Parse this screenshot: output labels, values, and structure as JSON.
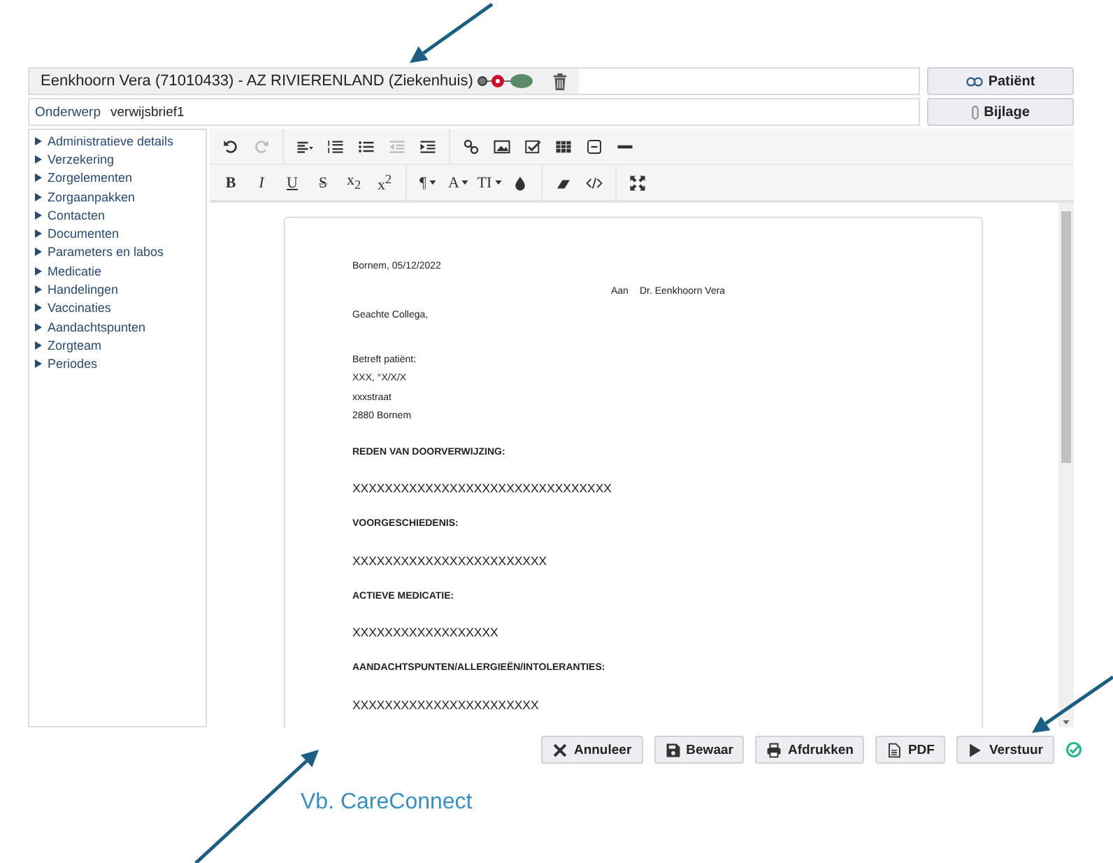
{
  "patient_bar": {
    "patient": "Eenkhoorn Vera (71010433) - AZ RIVIERENLAND (Ziekenhuis)",
    "patient_button": "Patiënt"
  },
  "subject": {
    "label": "Onderwerp",
    "value": "verwijsbrief1",
    "attachment_button": "Bijlage"
  },
  "sidebar": {
    "items": [
      {
        "label": "Administratieve details",
        "expanded": false
      },
      {
        "label": "Verzekering",
        "expanded": false
      },
      {
        "label": "Zorgelementen",
        "expanded": false
      },
      {
        "label": "Zorgaanpakken",
        "expanded": false
      },
      {
        "label": "Contacten",
        "expanded": false
      },
      {
        "label": "Documenten",
        "expanded": false
      },
      {
        "label": "Parameters en labos",
        "expanded": false
      },
      {
        "label": "Medicatie",
        "expanded": false
      },
      {
        "label": "Handelingen",
        "expanded": false
      },
      {
        "label": "Vaccinaties",
        "expanded": false
      },
      {
        "label": "Aandachtspunten",
        "expanded": false
      },
      {
        "label": "Zorgteam",
        "expanded": false
      },
      {
        "label": "Periodes",
        "expanded": false
      }
    ]
  },
  "toolbar": {
    "rows": [
      [
        [
          {
            "kind": "icon",
            "disabled": false
          },
          {
            "kind": "icon",
            "disabled": true
          }
        ],
        [
          {
            "kind": "icon",
            "disabled": false
          },
          {
            "kind": "icon",
            "disabled": false
          },
          {
            "kind": "icon",
            "disabled": false
          },
          {
            "kind": "icon",
            "disabled": true
          },
          {
            "kind": "icon",
            "disabled": false
          }
        ],
        [
          {
            "kind": "icon",
            "disabled": false
          },
          {
            "kind": "icon",
            "disabled": false
          },
          {
            "kind": "icon",
            "disabled": false
          },
          {
            "kind": "icon",
            "disabled": false
          },
          {
            "kind": "icon",
            "disabled": false
          },
          {
            "kind": "icon",
            "disabled": false
          }
        ]
      ],
      [
        [
          {
            "kind": "bold",
            "label": "B",
            "disabled": false
          },
          {
            "kind": "italic",
            "label": "I",
            "disabled": false
          },
          {
            "kind": "underline",
            "label": "U",
            "disabled": false
          },
          {
            "kind": "strike",
            "label": "S",
            "disabled": false
          },
          {
            "kind": "plain",
            "label": "x$_{2}$",
            "disabled": false
          },
          {
            "kind": "plain",
            "label": "x$^{2}$",
            "disabled": false
          }
        ],
        [
          {
            "kind": "dropdown",
            "label": "¶",
            "disabled": false
          },
          {
            "kind": "dropdown",
            "label": "A",
            "disabled": false
          },
          {
            "kind": "dropdown",
            "label": "TI",
            "disabled": false
          },
          {
            "kind": "icon",
            "disabled": false
          }
        ],
        [
          {
            "kind": "icon",
            "disabled": false
          },
          {
            "kind": "icon",
            "disabled": false
          }
        ],
        [
          {
            "kind": "icon",
            "disabled": false
          }
        ]
      ]
    ]
  },
  "document": {
    "lines": [
      {
        "kind": "text",
        "text": "Bornem, 05/12/2022"
      },
      {
        "kind": "addressee",
        "label": "Aan",
        "text": "Dr. Eenkhoorn Vera"
      },
      {
        "kind": "text",
        "text": "Geachte Collega,"
      },
      {
        "kind": "text",
        "text": "Betreft patiënt:",
        "space_before": true
      },
      {
        "kind": "text",
        "text": "XXX, °X/X/X"
      },
      {
        "kind": "text",
        "text": "xxxstraat"
      },
      {
        "kind": "text",
        "text": "2880 Bornem"
      },
      {
        "kind": "heading",
        "text": "REDEN VAN DOORVERWIJZING:"
      },
      {
        "kind": "placeholder",
        "text": "XXXXXXXXXXXXXXXXXXXXXXXXXXXXXXXX"
      },
      {
        "kind": "heading",
        "text": "VOORGESCHIEDENIS:"
      },
      {
        "kind": "placeholder",
        "text": "XXXXXXXXXXXXXXXXXXXXXXXX"
      },
      {
        "kind": "heading",
        "text": "ACTIEVE MEDICATIE:"
      },
      {
        "kind": "placeholder",
        "text": "XXXXXXXXXXXXXXXXXX"
      },
      {
        "kind": "heading",
        "text": "AANDACHTSPUNTEN/ALLERGIEËN/INTOLERANTIES:"
      },
      {
        "kind": "placeholder",
        "text": "XXXXXXXXXXXXXXXXXXXXXXX"
      }
    ]
  },
  "actions": [
    {
      "kind": "cancel",
      "label": "Annuleer"
    },
    {
      "kind": "save",
      "label": "Bewaar"
    },
    {
      "kind": "print",
      "label": "Afdrukken"
    },
    {
      "kind": "pdf",
      "label": "PDF"
    },
    {
      "kind": "send",
      "label": "Verstuur"
    }
  ],
  "caption": "Vb. CareConnect"
}
